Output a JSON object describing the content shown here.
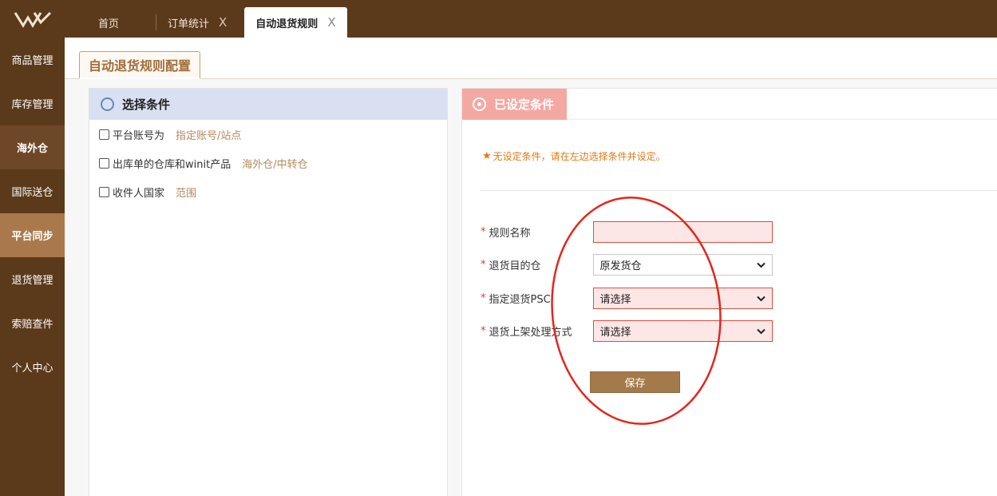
{
  "topbar": {
    "tabs": [
      {
        "label": "首页"
      },
      {
        "label": "订单统计",
        "close": "X"
      },
      {
        "label": "自动退货规则",
        "close": "X"
      }
    ]
  },
  "sidebar": {
    "items": [
      {
        "label": "商品管理"
      },
      {
        "label": "库存管理"
      },
      {
        "label": "海外仓"
      },
      {
        "label": "国际送仓"
      },
      {
        "label": "平台同步"
      },
      {
        "label": "退货管理"
      },
      {
        "label": "索赔查件"
      },
      {
        "label": "个人中心"
      }
    ]
  },
  "page": {
    "tab_title": "自动退货规则配置"
  },
  "left_panel": {
    "title": "选择条件",
    "conditions": [
      {
        "name": "平台账号为",
        "link": "指定账号/站点"
      },
      {
        "name": "出库单的仓库和winit产品",
        "link": "海外仓/中转仓"
      },
      {
        "name": "收件人国家",
        "link": "范围"
      }
    ]
  },
  "right_panel": {
    "title": "已设定条件",
    "notice": "无设定条件，请在左边选择条件并设定。",
    "form": {
      "required_mark": "*",
      "rule_name_label": "规则名称",
      "rule_name_value": "",
      "dest_label": "退货目的仓",
      "dest_value": "原发货仓",
      "psc_label": "指定退货PSC",
      "psc_value": "请选择",
      "shelf_label": "退货上架处理方式",
      "shelf_value": "请选择",
      "save_label": "保存"
    }
  },
  "colors": {
    "brand_dark": "#5b3a1b",
    "accent": "#a47a4a",
    "annotation": "#e3261b"
  }
}
